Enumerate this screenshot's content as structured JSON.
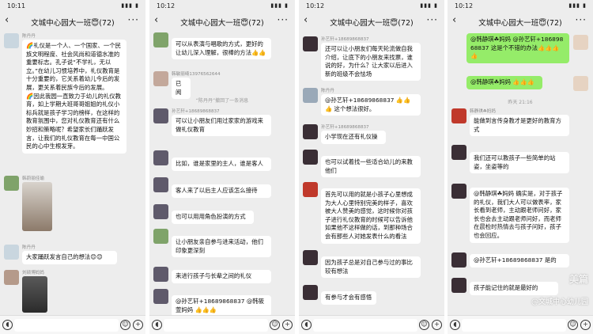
{
  "panels": [
    {
      "time": "10:11",
      "signal": "▮▮▮ ▮",
      "title": "文城中心园大一班😇(72)",
      "messages": [
        {
          "name": "陈丹丹",
          "text": "🌈礼仪是一个人、一个国家、一个民族文明程度、社会风尚和道德水准的重要标志。孔子说“不学礼，无以立。”在幼儿习惯培养中，礼仪教育是十分重要的，它关系着幼儿今后的发展，更关系着民族今后的发展。\n🌈因此我园一直致力于幼儿的礼仪教育，如上学期大班哥哥姐姐的礼仪小标兵就是孩子学习的榜样，在这样的教育氛围中，您对礼仪教育还有什么妙招和策略呢？希望家长们踊跃发言，让我们的礼仪教育在每一中国公民的心中生根发芽。"
        },
        {
          "name": "韩蔚丽佳瑜"
        },
        {
          "name": "陈丹丹",
          "text": "大家踊跃发言自己的想法😊😊"
        },
        {
          "name": "刘硕博妈妈"
        }
      ]
    },
    {
      "time": "10:12",
      "signal": "▮▮▮ ▮",
      "title": "文城中心园大一班😇(72)",
      "messages": [
        {
          "text": "可以从表演与唱歌的方式，更好的让幼儿深入理解，很棒的方法👍👍"
        },
        {
          "name": "韩敏丽绮13976562644",
          "text": "已阅"
        },
        {
          "system": "“陈丹丹”撤回了一条消息"
        },
        {
          "name": "孙艺轩+18689868837",
          "text": "可以让小朋友们用过家家的游戏来做礼仪教育"
        },
        {
          "text": "比如，谁是家里的主人，谁是客人"
        },
        {
          "text": "客人来了以后主人应该怎么接待"
        },
        {
          "text": "也可以用用角色扮演的方式"
        },
        {
          "text": "让小朋友亲自参与进来活动，他们印象更深刻"
        },
        {
          "text": "来进行孩子与长辈之间的礼仪"
        },
        {
          "text": "@孙艺轩+18689868837 @韩筱萱妈妈 👍👍👍"
        }
      ]
    },
    {
      "time": "10:12",
      "signal": "▮▮▮ ▮",
      "title": "文城中心园大一班😇(72)",
      "messages": [
        {
          "name": "孙艺轩+18689868837",
          "text": "还可以让小朋友们每天轮流做自我介绍，让底下的小朋友来找票，谁说的好，为什么？让大家以后进入新的班级不会怯场"
        },
        {
          "name": "陈丹丹",
          "text": "@孙艺轩+18689868837 👍👍👍 这个想法很好。"
        },
        {
          "name": "孙艺轩+18689868837",
          "text": "小学现在还有礼仪操"
        },
        {
          "text": "也可以试着找一些适合幼儿的来教他们"
        },
        {
          "text": "首先可以用的就是小孩子心里想成为大人心里特别完美的样子，喜欢被大人赞美的感觉，这时候你对孩子进行礼仪教育的时候可以告诉他如果他不这样做的话，到那种场合会有那些人对她发表什么的看法"
        },
        {
          "text": "因为孩子总是对自己参与过的事比较有想法"
        },
        {
          "text": "有参与才会有感悟"
        }
      ]
    },
    {
      "time": "10:12",
      "signal": "▮▮▮ ▮",
      "title": "文城中心园大一班😇(72)",
      "messages": [
        {
          "text": "@韩静琪☘妈妈 @孙艺轩+18689868837 这是个不错的办法👍👍👍👍"
        },
        {
          "text": "@韩静琪☘妈妈 👍👍👍"
        },
        {
          "system": "昨天 21:16"
        },
        {
          "name": "韩静琪☘妈妈",
          "text": "能做到言传身教才是更好的教育方式"
        },
        {
          "text": "我们还可以教孩子一些简单的站姿，坐姿等的"
        },
        {
          "text": "@韩静琪☘妈妈 确实是，对于孩子的礼仪，我们大人可以做表率，家长看到老师，主动跟老师问好，家长也会去主动跟老师问好，而老师在晨检时热情去与孩子问好，孩子也会回应。"
        },
        {
          "text": "@孙艺轩+18689868837 是的"
        },
        {
          "text": "孩子能记住的就是最好的"
        }
      ],
      "watermark": "美篇",
      "watermark2": "@文城中心幼儿园"
    }
  ],
  "icons": {
    "voice": "voice-icon",
    "emoji": "emoji-icon",
    "plus": "plus-icon",
    "back": "back-icon",
    "more": "more-icon"
  }
}
